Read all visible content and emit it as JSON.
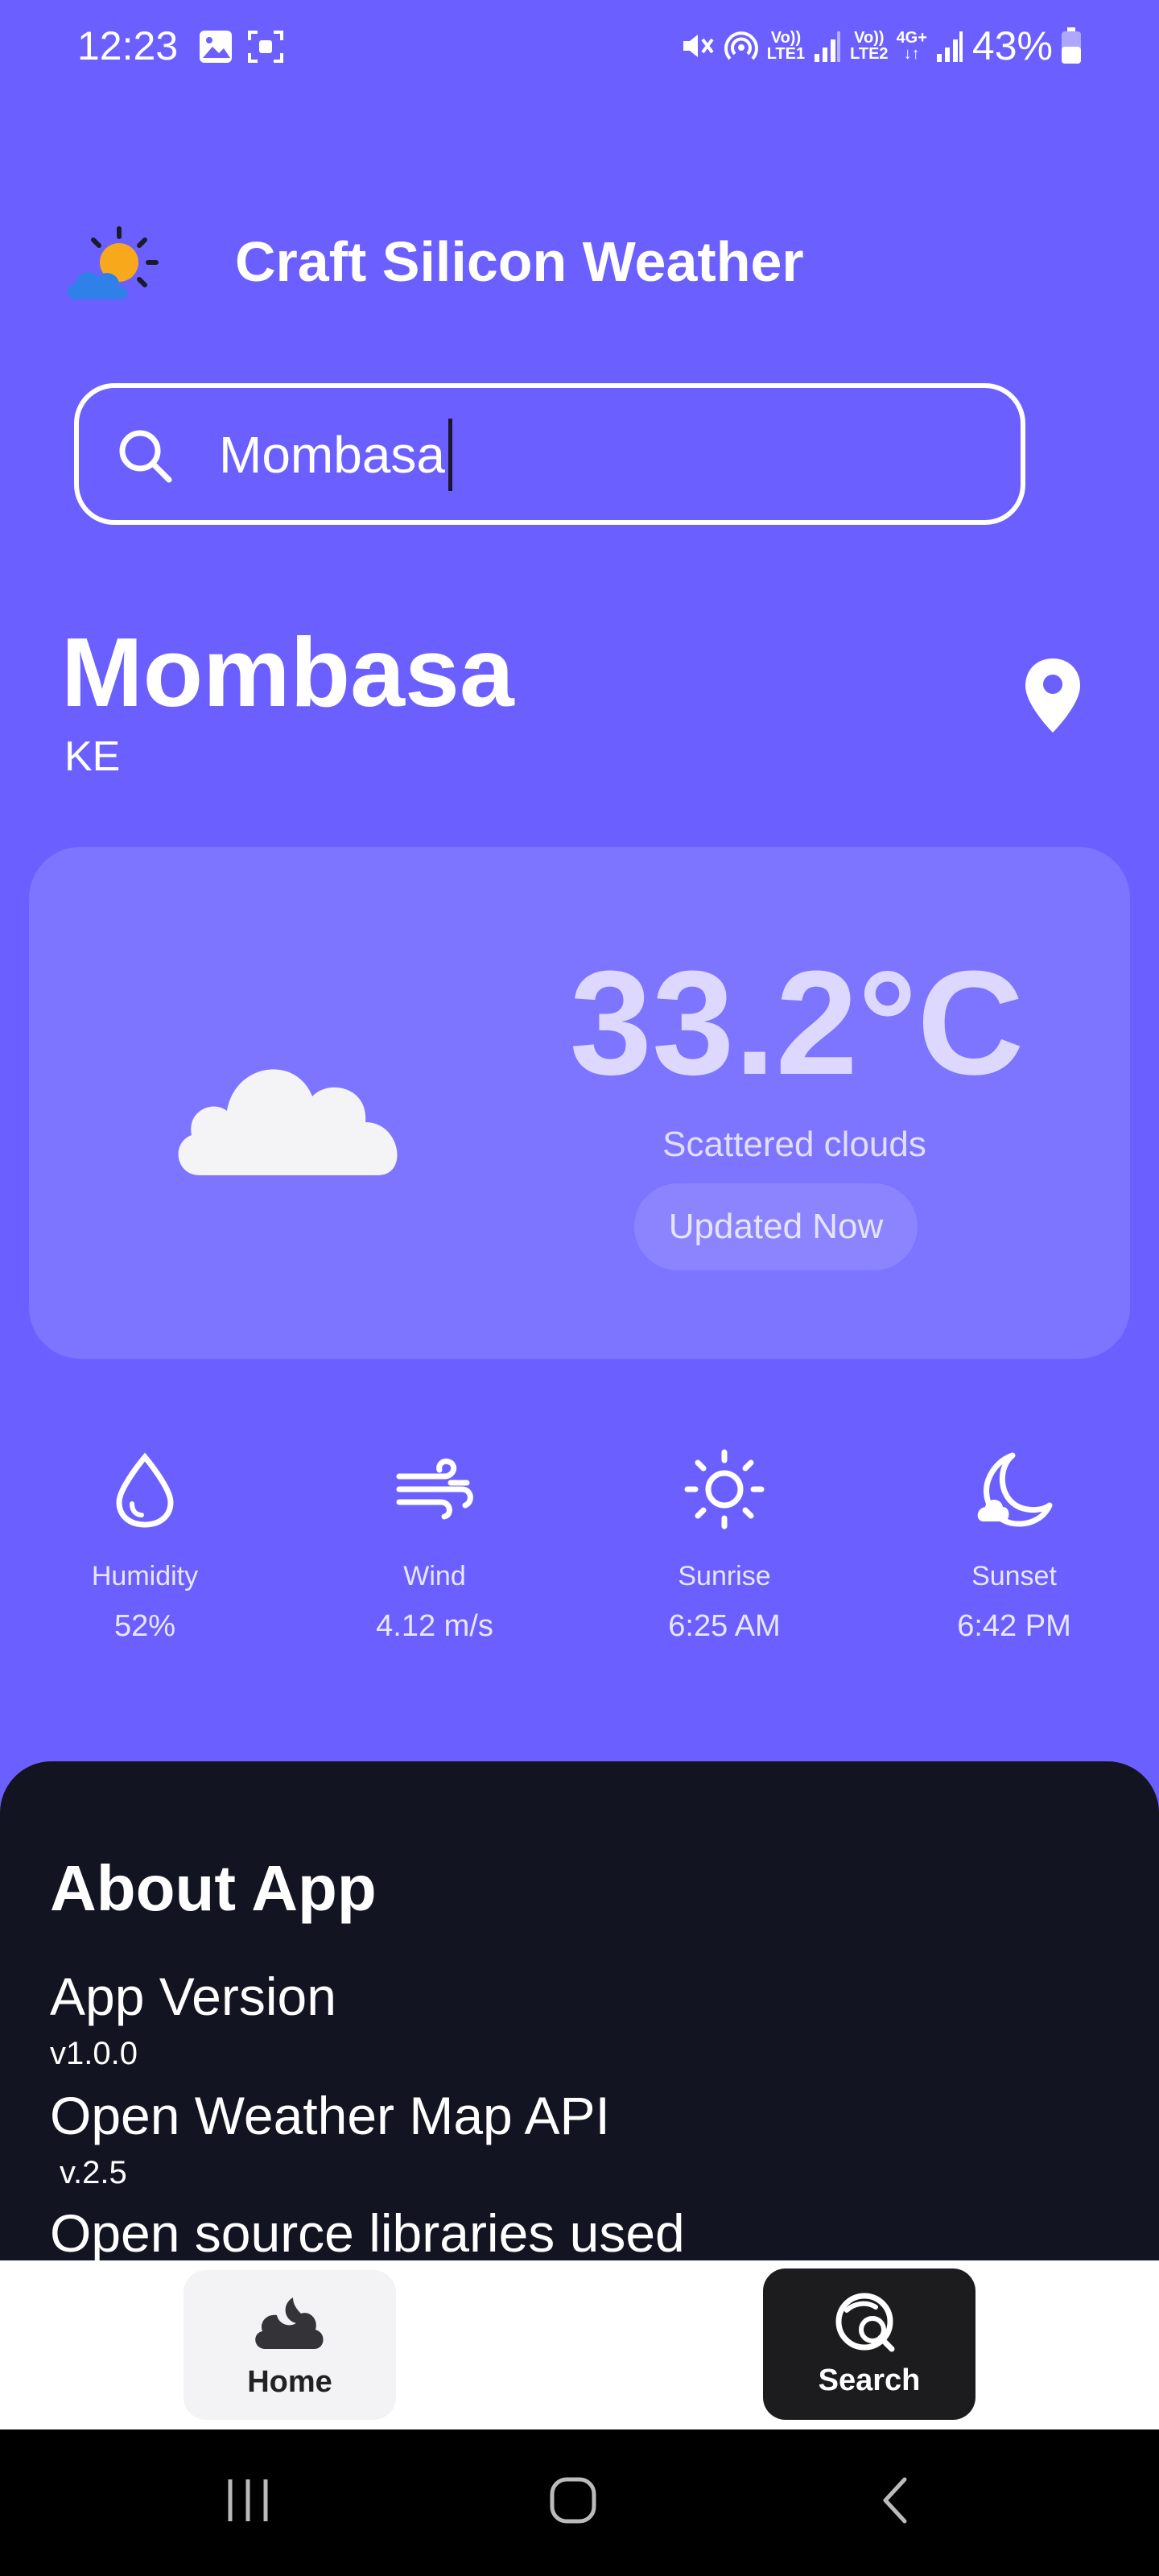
{
  "status_bar": {
    "time": "12:23",
    "battery": "43%",
    "sim1_top": "Vo))",
    "sim1_bottom": "LTE1",
    "sim2_top": "Vo))",
    "sim2_bottom": "LTE2",
    "network": "4G+"
  },
  "header": {
    "title": "Craft Silicon Weather",
    "logo_icon": "sun-cloud-icon"
  },
  "search": {
    "value": "Mombasa",
    "icon": "search-icon"
  },
  "location": {
    "city": "Mombasa",
    "country": "KE",
    "icon": "location-pin-icon"
  },
  "weather": {
    "temperature": "33.2°C",
    "description": "Scattered clouds",
    "updated": "Updated Now",
    "icon": "cloud-icon"
  },
  "stats": [
    {
      "label": "Humidity",
      "value": "52%",
      "icon": "droplet-icon"
    },
    {
      "label": "Wind",
      "value": "4.12 m/s",
      "icon": "wind-icon"
    },
    {
      "label": "Sunrise",
      "value": "6:25 AM",
      "icon": "sun-icon"
    },
    {
      "label": "Sunset",
      "value": "6:42 PM",
      "icon": "moon-cloud-icon"
    }
  ],
  "about": {
    "title": "About App",
    "app_version_label": "App Version",
    "app_version_value": "v1.0.0",
    "api_label": "Open Weather Map API",
    "api_value": "v.2.5",
    "libraries_label": "Open source libraries used"
  },
  "bottom_nav": {
    "home": "Home",
    "search": "Search"
  },
  "colors": {
    "background": "#6b60ff",
    "card": "#7d74ff",
    "about_bg": "#131421",
    "nav_active": "#1c1c1e"
  }
}
